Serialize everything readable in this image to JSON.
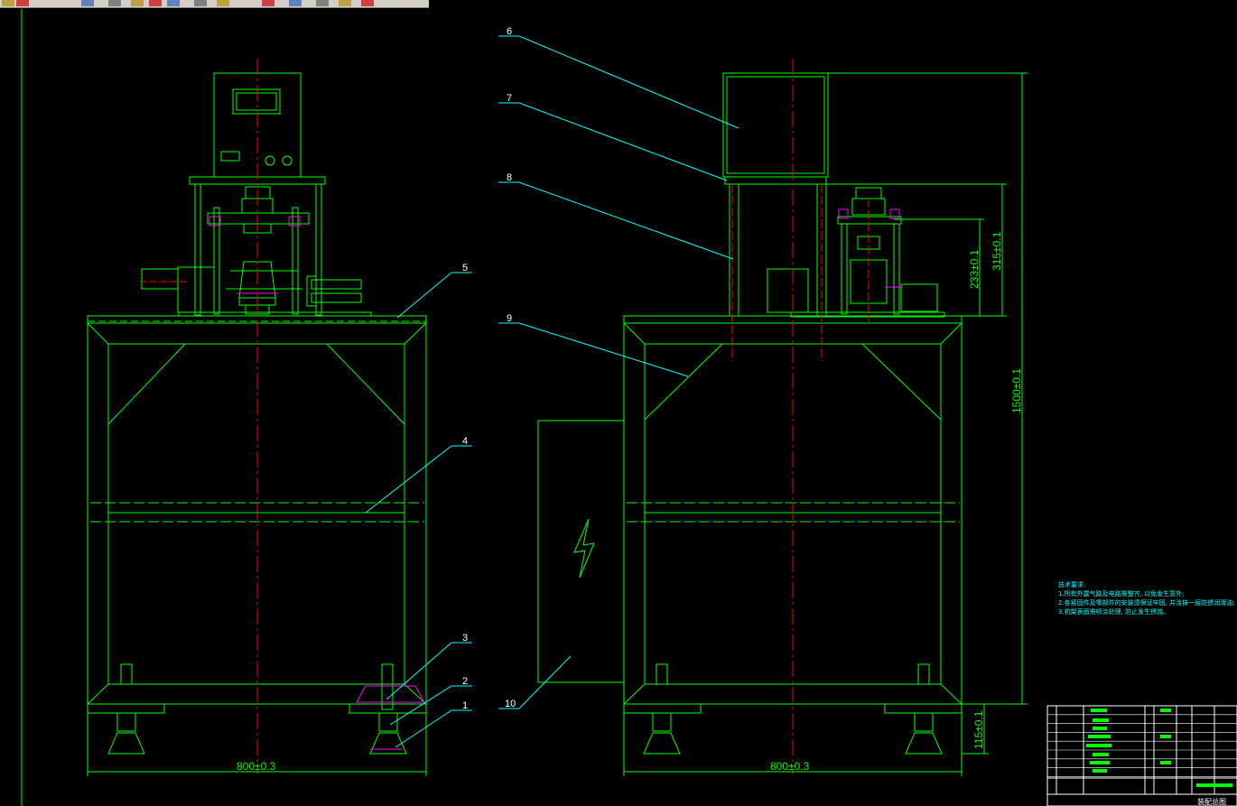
{
  "toolbar": {
    "tools": [
      {
        "icon": "open-icon"
      },
      {
        "icon": "print-icon"
      },
      {
        "icon": "pan-icon"
      },
      {
        "icon": "zoom-realtime-icon"
      },
      {
        "icon": "zoom-window-icon"
      },
      {
        "icon": "zoom-previous-icon"
      },
      {
        "icon": "zoom-extents-icon"
      },
      {
        "icon": "properties-icon"
      },
      {
        "icon": "design-center-icon"
      },
      {
        "icon": "tool-palette-icon"
      },
      {
        "icon": "sheet-set-icon"
      },
      {
        "icon": "markup-icon"
      },
      {
        "icon": "calculator-icon"
      },
      {
        "icon": "help-icon"
      }
    ]
  },
  "drawing": {
    "colors": {
      "background": "#000000",
      "outline": "#00ff00",
      "center_line": "#ff0000",
      "leader": "#00ffff",
      "dimension": "#00ff00",
      "highlight": "#ff00ff",
      "hatch": "#ffff00"
    },
    "balloons": [
      {
        "id": "balloon-1",
        "label": "1"
      },
      {
        "id": "balloon-2",
        "label": "2"
      },
      {
        "id": "balloon-3",
        "label": "3"
      },
      {
        "id": "balloon-4",
        "label": "4"
      },
      {
        "id": "balloon-5",
        "label": "5"
      },
      {
        "id": "balloon-6",
        "label": "6"
      },
      {
        "id": "balloon-7",
        "label": "7"
      },
      {
        "id": "balloon-8",
        "label": "8"
      },
      {
        "id": "balloon-9",
        "label": "9"
      },
      {
        "id": "balloon-10",
        "label": "10"
      }
    ],
    "dimensions": {
      "front_width": "800±0.3",
      "side_width": "800±0.3",
      "total_height": "1500±0.1",
      "frame_height": "315±0.1",
      "press_height": "233±0.1",
      "foot_height": "115±0.1"
    },
    "notes": {
      "title": "技术要求:",
      "lines": [
        "1.所有外露气路及电路需整齐, 以免发生意外;",
        "2.各紧固件及零部件的安装须保证牢固, 并涂抹一层防锈润滑油;",
        "3.机架表面需喷涂处理, 防止发生锈蚀。"
      ]
    },
    "title_block": {
      "drawing_name": "装配总图"
    }
  }
}
